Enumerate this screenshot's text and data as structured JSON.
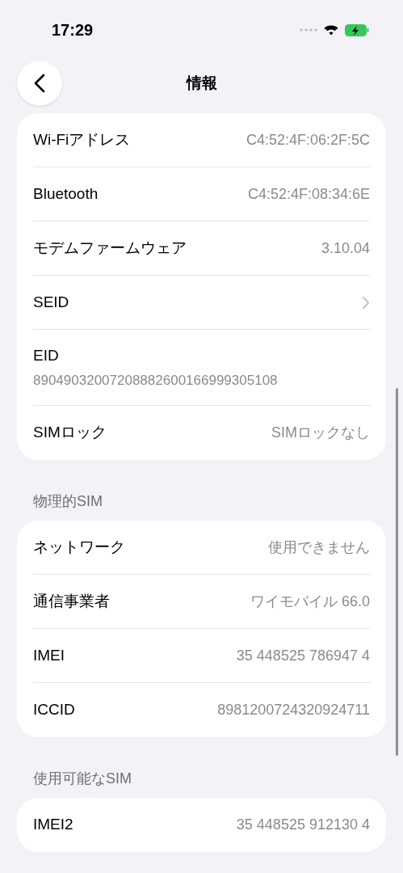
{
  "status_bar": {
    "time": "17:29"
  },
  "nav": {
    "title": "情報"
  },
  "sections": [
    {
      "rows": [
        {
          "kind": "value",
          "label": "Wi-Fiアドレス",
          "value": "C4:52:4F:06:2F:5C"
        },
        {
          "kind": "value",
          "label": "Bluetooth",
          "value": "C4:52:4F:08:34:6E"
        },
        {
          "kind": "value",
          "label": "モデムファームウェア",
          "value": "3.10.04"
        },
        {
          "kind": "chevron",
          "label": "SEID"
        },
        {
          "kind": "stacked",
          "label": "EID",
          "value": "89049032007208882600166999305108"
        },
        {
          "kind": "value",
          "label": "SIMロック",
          "value": "SIMロックなし"
        }
      ]
    },
    {
      "header": "物理的SIM",
      "rows": [
        {
          "kind": "value",
          "label": "ネットワーク",
          "value": "使用できません"
        },
        {
          "kind": "value",
          "label": "通信事業者",
          "value": "ワイモバイル 66.0"
        },
        {
          "kind": "value",
          "label": "IMEI",
          "value": "35 448525 786947 4"
        },
        {
          "kind": "value",
          "label": "ICCID",
          "value": "8981200724320924711"
        }
      ]
    },
    {
      "header": "使用可能なSIM",
      "rows": [
        {
          "kind": "value",
          "label": "IMEI2",
          "value": "35 448525 912130 4"
        }
      ]
    }
  ]
}
